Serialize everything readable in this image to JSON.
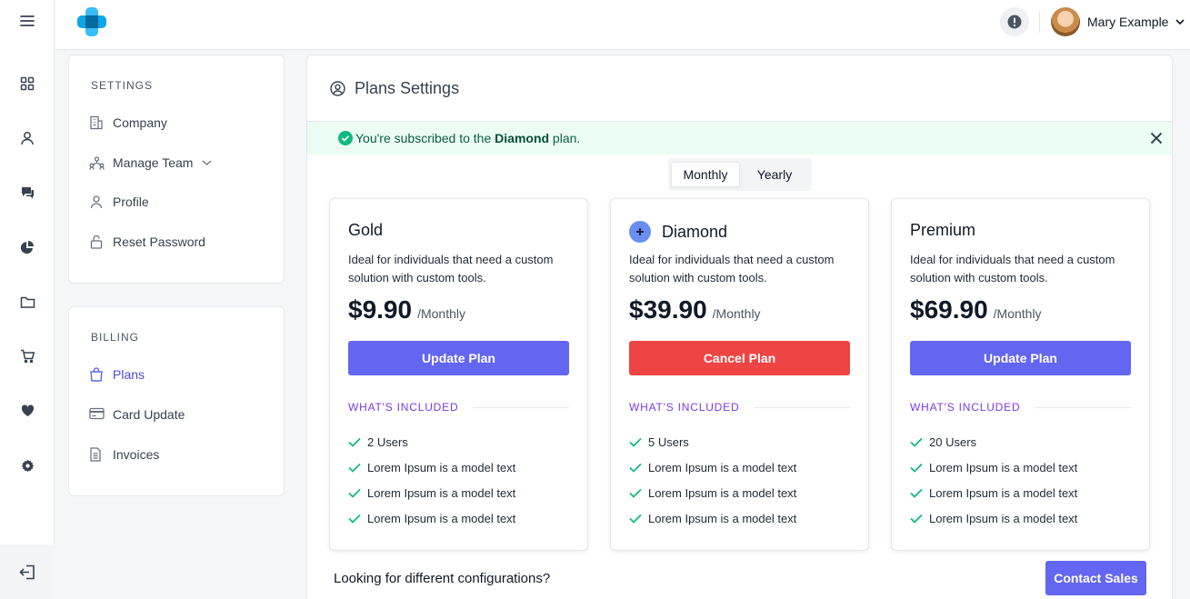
{
  "user": {
    "name": "Mary Example"
  },
  "settings": {
    "heading": "SETTINGS",
    "items": [
      {
        "label": "Company",
        "icon": "building-icon"
      },
      {
        "label": "Manage Team",
        "icon": "team-icon"
      },
      {
        "label": "Profile",
        "icon": "user-icon"
      },
      {
        "label": "Reset Password",
        "icon": "lock-icon"
      }
    ]
  },
  "billing": {
    "heading": "BILLING",
    "items": [
      {
        "label": "Plans",
        "icon": "bag-icon",
        "active": true
      },
      {
        "label": "Card Update",
        "icon": "card-icon"
      },
      {
        "label": "Invoices",
        "icon": "document-icon"
      }
    ]
  },
  "main": {
    "title": "Plans Settings",
    "banner": {
      "prefix": "You're subscribed to the ",
      "plan": "Diamond",
      "suffix": " plan."
    },
    "toggle": {
      "monthly": "Monthly",
      "yearly": "Yearly",
      "selected": "Monthly"
    },
    "plans": [
      {
        "name": "Gold",
        "description": "Ideal for individuals that need a custom solution with custom tools.",
        "price": "$9.90",
        "period": "/Monthly",
        "button": "Update Plan",
        "button_color": "#6366f1",
        "included_label": "WHAT'S INCLUDED",
        "features": [
          "2 Users",
          "Lorem Ipsum is a model text",
          "Lorem Ipsum is a model text",
          "Lorem Ipsum is a model text"
        ]
      },
      {
        "name": "Diamond",
        "description": "Ideal for individuals that need a custom solution with custom tools.",
        "price": "$39.90",
        "period": "/Monthly",
        "button": "Cancel Plan",
        "button_color": "#ef4444",
        "included_label": "WHAT'S INCLUDED",
        "features": [
          "5 Users",
          "Lorem Ipsum is a model text",
          "Lorem Ipsum is a model text",
          "Lorem Ipsum is a model text"
        ]
      },
      {
        "name": "Premium",
        "description": "Ideal for individuals that need a custom solution with custom tools.",
        "price": "$69.90",
        "period": "/Monthly",
        "button": "Update Plan",
        "button_color": "#6366f1",
        "included_label": "WHAT'S INCLUDED",
        "features": [
          "20 Users",
          "Lorem Ipsum is a model text",
          "Lorem Ipsum is a model text",
          "Lorem Ipsum is a model text"
        ]
      }
    ],
    "footer": {
      "text": "Looking for different configurations?",
      "button": "Contact Sales"
    }
  },
  "colors": {
    "accent": "#6366f1",
    "danger": "#ef4444",
    "success": "#10b981",
    "label": "#7c3aed"
  }
}
